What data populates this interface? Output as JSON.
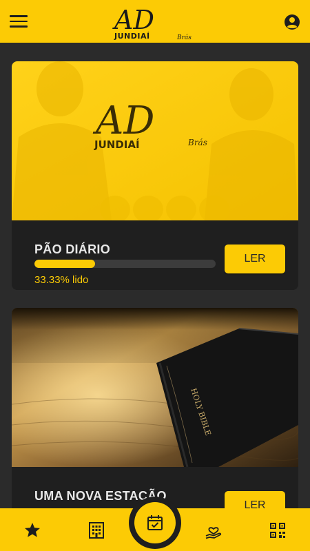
{
  "header": {
    "logo_text": "AD",
    "logo_sub": "JUNDIAÍ",
    "logo_script": "Brás"
  },
  "feed": [
    {
      "title": "PÃO DIÁRIO",
      "progress": 33.33,
      "progress_text": "33.33% lido",
      "button_label": "LER"
    },
    {
      "title": "UMA NOVA ESTAÇÃO",
      "button_label": "LER",
      "image_text": "HOLY BIBLE"
    }
  ],
  "bottom_nav": {
    "items": [
      "star-icon",
      "building-icon",
      "calendar-check-icon",
      "hand-heart-icon",
      "qr-code-icon"
    ],
    "active": "calendar-check-icon"
  },
  "colors": {
    "accent": "#fccb05",
    "background": "#2b2b2b",
    "card": "#1f1f1f",
    "track": "#3c3c3c"
  }
}
